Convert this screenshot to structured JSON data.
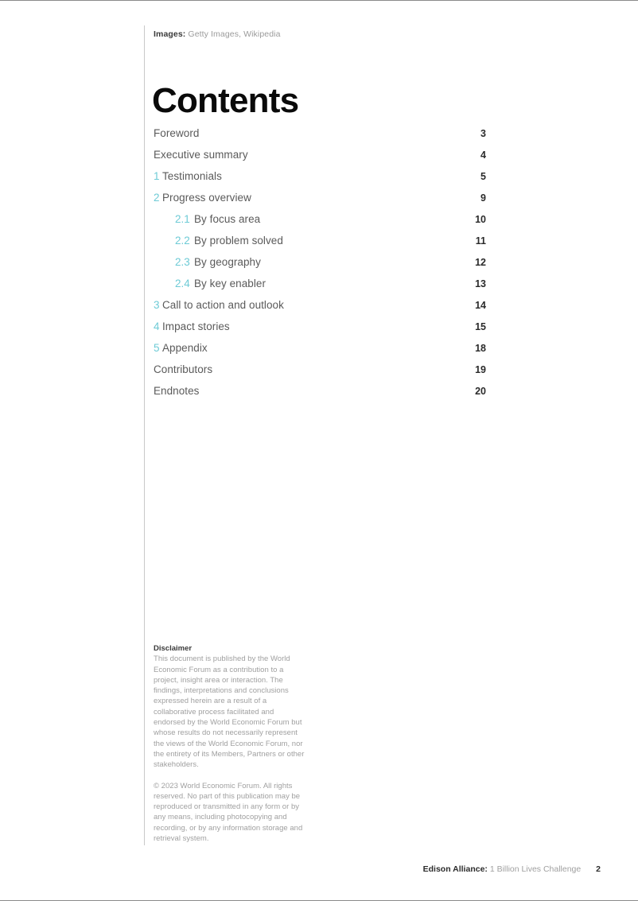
{
  "credit": {
    "label": "Images:",
    "sources": "Getty Images, Wikipedia"
  },
  "title": "Contents",
  "accent_color": "#6ecbd6",
  "toc": {
    "entries": [
      {
        "number": "",
        "level": 0,
        "label": "Foreword",
        "page": "3"
      },
      {
        "number": "",
        "level": 0,
        "label": "Executive summary",
        "page": "4"
      },
      {
        "number": "1",
        "level": 1,
        "label": "Testimonials",
        "page": "5"
      },
      {
        "number": "2",
        "level": 1,
        "label": "Progress overview",
        "page": "9"
      },
      {
        "number": "2.1",
        "level": 2,
        "label": "By focus area",
        "page": "10"
      },
      {
        "number": "2.2",
        "level": 2,
        "label": "By problem solved",
        "page": "11"
      },
      {
        "number": "2.3",
        "level": 2,
        "label": "By geography",
        "page": "12"
      },
      {
        "number": "2.4",
        "level": 2,
        "label": "By key enabler",
        "page": "13"
      },
      {
        "number": "3",
        "level": 1,
        "label": "Call to action and outlook",
        "page": "14"
      },
      {
        "number": "4",
        "level": 1,
        "label": "Impact stories",
        "page": "15"
      },
      {
        "number": "5",
        "level": 1,
        "label": "Appendix",
        "page": "18"
      },
      {
        "number": "",
        "level": 0,
        "label": "Contributors",
        "page": "19"
      },
      {
        "number": "",
        "level": 0,
        "label": "Endnotes",
        "page": "20"
      }
    ]
  },
  "disclaimer": {
    "heading": "Disclaimer",
    "body": "This document is published by the World Economic Forum as a contribution to a project, insight area or interaction. The findings, interpretations and conclusions expressed herein are a result of a collaborative process facilitated and endorsed by the World Economic Forum but whose results do not necessarily represent the views of the World Economic Forum, nor the entirety of its Members, Partners or other stakeholders.",
    "copyright": "© 2023 World Economic Forum. All rights reserved. No part of this publication may be reproduced or transmitted in any form or by any means, including photocopying and recording, or by any information storage and retrieval system."
  },
  "footer": {
    "brand": "Edison Alliance:",
    "subtitle": "1 Billion Lives Challenge",
    "page_number": "2"
  }
}
